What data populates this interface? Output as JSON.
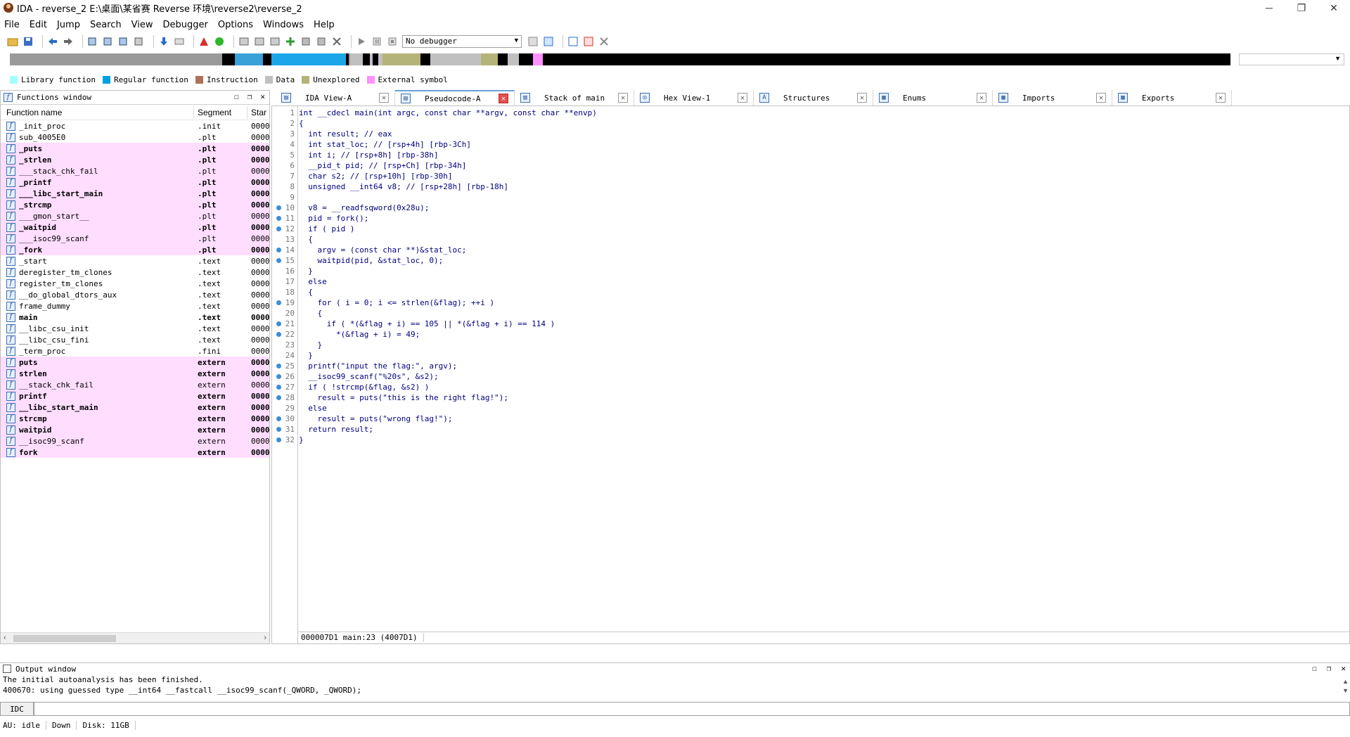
{
  "window": {
    "title": "IDA - reverse_2 E:\\桌面\\某省赛 Reverse 环境\\reverse2\\reverse_2",
    "minimize": "─",
    "restore": "❐",
    "close": "✕"
  },
  "menu": [
    "File",
    "Edit",
    "Jump",
    "Search",
    "View",
    "Debugger",
    "Options",
    "Windows",
    "Help"
  ],
  "toolbar": {
    "debugger_label": "No debugger"
  },
  "legend": [
    {
      "label": "Library function",
      "color": "#a0ffff"
    },
    {
      "label": "Regular function",
      "color": "#00a0e0"
    },
    {
      "label": "Instruction",
      "color": "#b07058"
    },
    {
      "label": "Data",
      "color": "#c0c0c0"
    },
    {
      "label": "Unexplored",
      "color": "#b4b478"
    },
    {
      "label": "External symbol",
      "color": "#ff90ff"
    }
  ],
  "functions_window": {
    "title": "Functions window",
    "columns": [
      "Function name",
      "Segment",
      "Star"
    ],
    "rows": [
      {
        "name": "_init_proc",
        "segment": ".init",
        "start": "0000",
        "pink": false,
        "bold": false
      },
      {
        "name": "sub_4005E0",
        "segment": ".plt",
        "start": "0000",
        "pink": false,
        "bold": false
      },
      {
        "name": "_puts",
        "segment": ".plt",
        "start": "0000",
        "pink": true,
        "bold": true
      },
      {
        "name": "_strlen",
        "segment": ".plt",
        "start": "0000",
        "pink": true,
        "bold": true
      },
      {
        "name": "___stack_chk_fail",
        "segment": ".plt",
        "start": "0000",
        "pink": true,
        "bold": false
      },
      {
        "name": "_printf",
        "segment": ".plt",
        "start": "0000",
        "pink": true,
        "bold": true
      },
      {
        "name": "___libc_start_main",
        "segment": ".plt",
        "start": "0000",
        "pink": true,
        "bold": true
      },
      {
        "name": "_strcmp",
        "segment": ".plt",
        "start": "0000",
        "pink": true,
        "bold": true
      },
      {
        "name": "___gmon_start__",
        "segment": ".plt",
        "start": "0000",
        "pink": true,
        "bold": false
      },
      {
        "name": "_waitpid",
        "segment": ".plt",
        "start": "0000",
        "pink": true,
        "bold": true
      },
      {
        "name": "___isoc99_scanf",
        "segment": ".plt",
        "start": "0000",
        "pink": true,
        "bold": false
      },
      {
        "name": "_fork",
        "segment": ".plt",
        "start": "0000",
        "pink": true,
        "bold": true
      },
      {
        "name": "_start",
        "segment": ".text",
        "start": "0000",
        "pink": false,
        "bold": false
      },
      {
        "name": "deregister_tm_clones",
        "segment": ".text",
        "start": "0000",
        "pink": false,
        "bold": false
      },
      {
        "name": "register_tm_clones",
        "segment": ".text",
        "start": "0000",
        "pink": false,
        "bold": false
      },
      {
        "name": "__do_global_dtors_aux",
        "segment": ".text",
        "start": "0000",
        "pink": false,
        "bold": false
      },
      {
        "name": "frame_dummy",
        "segment": ".text",
        "start": "0000",
        "pink": false,
        "bold": false
      },
      {
        "name": "main",
        "segment": ".text",
        "start": "0000",
        "pink": false,
        "bold": true
      },
      {
        "name": "__libc_csu_init",
        "segment": ".text",
        "start": "0000",
        "pink": false,
        "bold": false
      },
      {
        "name": "__libc_csu_fini",
        "segment": ".text",
        "start": "0000",
        "pink": false,
        "bold": false
      },
      {
        "name": "_term_proc",
        "segment": ".fini",
        "start": "0000",
        "pink": false,
        "bold": false
      },
      {
        "name": "puts",
        "segment": "extern",
        "start": "0000",
        "pink": true,
        "bold": true
      },
      {
        "name": "strlen",
        "segment": "extern",
        "start": "0000",
        "pink": true,
        "bold": true
      },
      {
        "name": "__stack_chk_fail",
        "segment": "extern",
        "start": "0000",
        "pink": true,
        "bold": false
      },
      {
        "name": "printf",
        "segment": "extern",
        "start": "0000",
        "pink": true,
        "bold": true
      },
      {
        "name": "__libc_start_main",
        "segment": "extern",
        "start": "0000",
        "pink": true,
        "bold": true
      },
      {
        "name": "strcmp",
        "segment": "extern",
        "start": "0000",
        "pink": true,
        "bold": true
      },
      {
        "name": "waitpid",
        "segment": "extern",
        "start": "0000",
        "pink": true,
        "bold": true
      },
      {
        "name": "__isoc99_scanf",
        "segment": "extern",
        "start": "0000",
        "pink": true,
        "bold": false
      },
      {
        "name": "fork",
        "segment": "extern",
        "start": "0000",
        "pink": true,
        "bold": true
      }
    ]
  },
  "tabs": [
    {
      "label": "IDA View-A",
      "active": false,
      "icon": "ida-view-icon"
    },
    {
      "label": "Pseudocode-A",
      "active": true,
      "icon": "pseudocode-icon"
    },
    {
      "label": "Stack of main",
      "active": false,
      "icon": "stack-icon"
    },
    {
      "label": "Hex View-1",
      "active": false,
      "icon": "hex-icon"
    },
    {
      "label": "Structures",
      "active": false,
      "icon": "structures-icon"
    },
    {
      "label": "Enums",
      "active": false,
      "icon": "enums-icon"
    },
    {
      "label": "Imports",
      "active": false,
      "icon": "imports-icon"
    },
    {
      "label": "Exports",
      "active": false,
      "icon": "exports-icon"
    }
  ],
  "pseudocode": {
    "lines": [
      {
        "n": "1",
        "dot": false,
        "text": "int __cdecl main(int argc, const char **argv, const char **envp)"
      },
      {
        "n": "2",
        "dot": false,
        "text": "{"
      },
      {
        "n": "3",
        "dot": false,
        "text": "  int result; // eax"
      },
      {
        "n": "4",
        "dot": false,
        "text": "  int stat_loc; // [rsp+4h] [rbp-3Ch]"
      },
      {
        "n": "5",
        "dot": false,
        "text": "  int i; // [rsp+8h] [rbp-38h]"
      },
      {
        "n": "6",
        "dot": false,
        "text": "  __pid_t pid; // [rsp+Ch] [rbp-34h]"
      },
      {
        "n": "7",
        "dot": false,
        "text": "  char s2; // [rsp+10h] [rbp-30h]"
      },
      {
        "n": "8",
        "dot": false,
        "text": "  unsigned __int64 v8; // [rsp+28h] [rbp-18h]"
      },
      {
        "n": "9",
        "dot": false,
        "text": ""
      },
      {
        "n": "10",
        "dot": true,
        "text": "  v8 = __readfsqword(0x28u);"
      },
      {
        "n": "11",
        "dot": true,
        "text": "  pid = fork();"
      },
      {
        "n": "12",
        "dot": true,
        "text": "  if ( pid )"
      },
      {
        "n": "13",
        "dot": false,
        "text": "  {"
      },
      {
        "n": "14",
        "dot": true,
        "text": "    argv = (const char **)&stat_loc;"
      },
      {
        "n": "15",
        "dot": true,
        "text": "    waitpid(pid, &stat_loc, 0);"
      },
      {
        "n": "16",
        "dot": false,
        "text": "  }"
      },
      {
        "n": "17",
        "dot": false,
        "text": "  else"
      },
      {
        "n": "18",
        "dot": false,
        "text": "  {"
      },
      {
        "n": "19",
        "dot": true,
        "text": "    for ( i = 0; i <= strlen(&flag); ++i )"
      },
      {
        "n": "20",
        "dot": false,
        "text": "    {"
      },
      {
        "n": "21",
        "dot": true,
        "text": "      if ( *(&flag + i) == 105 || *(&flag + i) == 114 )"
      },
      {
        "n": "22",
        "dot": true,
        "text": "        *(&flag + i) = 49;"
      },
      {
        "n": "23",
        "dot": false,
        "text": "    }"
      },
      {
        "n": "24",
        "dot": false,
        "text": "  }"
      },
      {
        "n": "25",
        "dot": true,
        "text": "  printf(\"input the flag:\", argv);"
      },
      {
        "n": "26",
        "dot": true,
        "text": "  __isoc99_scanf(\"%20s\", &s2);"
      },
      {
        "n": "27",
        "dot": true,
        "text": "  if ( !strcmp(&flag, &s2) )"
      },
      {
        "n": "28",
        "dot": true,
        "text": "    result = puts(\"this is the right flag!\");"
      },
      {
        "n": "29",
        "dot": false,
        "text": "  else"
      },
      {
        "n": "30",
        "dot": true,
        "text": "    result = puts(\"wrong flag!\");"
      },
      {
        "n": "31",
        "dot": true,
        "text": "  return result;"
      },
      {
        "n": "32",
        "dot": true,
        "text": "}"
      }
    ],
    "status": "000007D1 main:23 (4007D1)"
  },
  "output_window": {
    "title": "Output window",
    "lines": [
      "The initial autoanalysis has been finished.",
      "400670: using guessed type __int64 __fastcall __isoc99_scanf(_QWORD, _QWORD);"
    ]
  },
  "command": {
    "label": "IDC"
  },
  "statusbar": {
    "au": "AU:  idle",
    "dir": "Down",
    "disk": "Disk: 11GB"
  }
}
